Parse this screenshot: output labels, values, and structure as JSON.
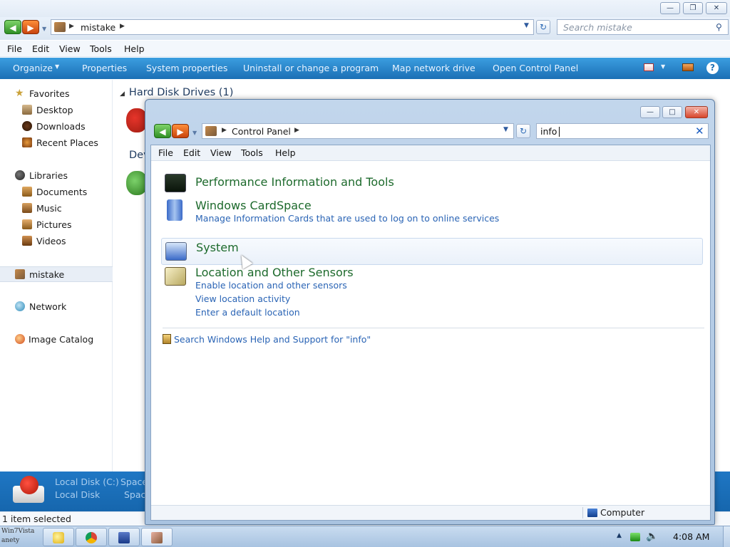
{
  "bg": {
    "address_path": "mistake",
    "search_placeholder": "Search mistake",
    "menu": [
      "File",
      "Edit",
      "View",
      "Tools",
      "Help"
    ],
    "toolbar": [
      "Organize",
      "Properties",
      "System properties",
      "Uninstall or change a program",
      "Map network drive",
      "Open Control Panel"
    ],
    "nav": {
      "favorites": "Favorites",
      "desktop": "Desktop",
      "downloads": "Downloads",
      "recent": "Recent Places",
      "libraries": "Libraries",
      "documents": "Documents",
      "music": "Music",
      "pictures": "Pictures",
      "videos": "Videos",
      "computer": "mistake",
      "network": "Network",
      "catalog": "Image Catalog"
    },
    "groups": {
      "hdd": "Hard Disk Drives (1)",
      "devices": "Dev"
    },
    "details": {
      "name": "Local Disk (C:)",
      "type": "Local Disk",
      "space1": "Space",
      "space2": "Spac"
    },
    "status": "1 item selected"
  },
  "cp": {
    "address_path": "Control Panel",
    "search_value": "info",
    "menu": [
      "File",
      "Edit",
      "View",
      "Tools",
      "Help"
    ],
    "results": {
      "perf_title": "Performance Information and Tools",
      "cardspace_title": "Windows CardSpace",
      "cardspace_link": "Manage Information Cards that are used to log on to online services",
      "system_title": "System",
      "sensors_title": "Location and Other Sensors",
      "sensors_link1": "Enable location and other sensors",
      "sensors_link2": "View location activity",
      "sensors_link3": "Enter a default location"
    },
    "help_link": "Search Windows Help and Support for \"info\"",
    "status_computer": "Computer"
  },
  "taskbar": {
    "start_text1": "Win7Vista",
    "start_text2": "anety",
    "clock": "4:08 AM"
  }
}
